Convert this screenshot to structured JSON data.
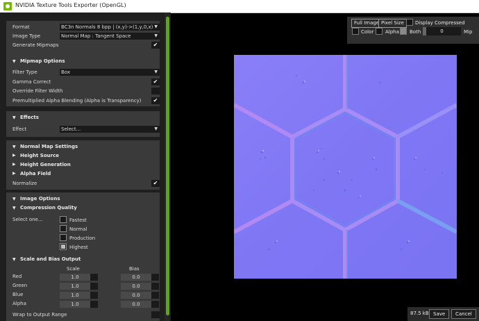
{
  "window": {
    "title": "NVIDIA Texture Tools Exporter (OpenGL)"
  },
  "format_section": {
    "format_label": "Format",
    "format_value": "BC3n   Normals   8 bpp | (x,y)->(1,y,0,x)",
    "image_type_label": "Image Type",
    "image_type_value": "Normal Map : Tangent Space",
    "gen_mipmaps_label": "Generate Mipmaps",
    "gen_mipmaps_checked": true
  },
  "mipmap_options": {
    "title": "Mipmap Options",
    "filter_type_label": "Filter Type",
    "filter_type_value": "Box",
    "gamma_label": "Gamma Correct",
    "gamma_checked": true,
    "override_label": "Override Filter Width",
    "override_checked": false,
    "premult_label": "Premultiplied Alpha Blending (Alpha is Transparency)",
    "premult_checked": true
  },
  "effects": {
    "title": "Effects",
    "effect_label": "Effect",
    "effect_value": "Select..."
  },
  "normal_map": {
    "title": "Normal Map Settings",
    "height_source": "Height Source",
    "height_generation": "Height Generation",
    "alpha_field": "Alpha Field",
    "normalize_label": "Normalize",
    "normalize_checked": true
  },
  "image_options": {
    "title": "Image Options",
    "compression_quality": "Compression Quality",
    "select_one": "Select one...",
    "options": [
      "Fastest",
      "Normal",
      "Production",
      "Highest"
    ],
    "selected": "Highest"
  },
  "scale_bias": {
    "title": "Scale and Bias Output",
    "scale_header": "Scale",
    "bias_header": "Bias",
    "rows": [
      {
        "label": "Red",
        "scale": "1.0",
        "bias": "0.0"
      },
      {
        "label": "Green",
        "scale": "1.0",
        "bias": "0.0"
      },
      {
        "label": "Blue",
        "scale": "1.0",
        "bias": "0.0"
      },
      {
        "label": "Alpha",
        "scale": "1.0",
        "bias": "0.0"
      }
    ],
    "wrap_label": "Wrap to Output Range"
  },
  "preview_controls": {
    "full_image": "Full Image",
    "pixel_size": "Pixel Size",
    "display_compressed": "Display Compressed",
    "color": "Color",
    "alpha": "Alpha",
    "both": "Both",
    "both_checked": true,
    "mip_value": "0",
    "mip_label": "Mip"
  },
  "status": {
    "file_size": "87.5 kB",
    "save": "Save",
    "cancel": "Cancel"
  },
  "colors": {
    "accent": "#5aa81a",
    "panel": "#3a3a3a",
    "background": "#000000",
    "normal_map_base": "#8077f5"
  }
}
